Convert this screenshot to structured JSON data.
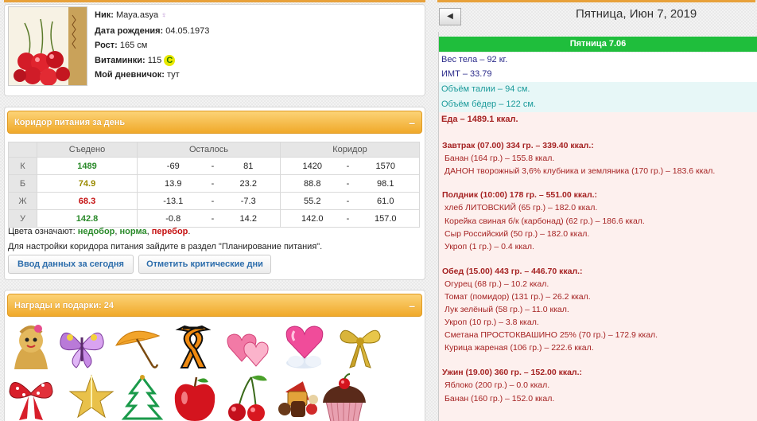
{
  "profile": {
    "nick_label": "Ник:",
    "nick": "Maya.asya",
    "dob_label": "Дата рождения:",
    "dob": "04.05.1973",
    "height_label": "Рост:",
    "height": "165 см",
    "vitamins_label": "Витаминки:",
    "vitamins": "115",
    "vitamin_badge": "C",
    "diary_label": "Мой дневничок:",
    "diary": "тут"
  },
  "corridor": {
    "title": "Коридор питания за день",
    "toggle": "–",
    "headers": [
      "",
      "Съедено",
      "Осталось",
      "Коридор"
    ],
    "rows": [
      {
        "label": "К",
        "eaten": "1489",
        "rem_min": "-69",
        "rem_max": "81",
        "cor_min": "1420",
        "cor_max": "1570"
      },
      {
        "label": "Б",
        "eaten": "74.9",
        "rem_min": "13.9",
        "rem_max": "23.2",
        "cor_min": "88.8",
        "cor_max": "98.1"
      },
      {
        "label": "Ж",
        "eaten": "68.3",
        "rem_min": "-13.1",
        "rem_max": "-7.3",
        "cor_min": "55.2",
        "cor_max": "61.0"
      },
      {
        "label": "У",
        "eaten": "142.8",
        "rem_min": "-0.8",
        "rem_max": "14.2",
        "cor_min": "142.0",
        "cor_max": "157.0"
      }
    ],
    "dash": "-",
    "legend_prefix": "Цвета означают:",
    "legend_under": "недобор",
    "legend_norm": "норма",
    "legend_over": "перебор",
    "note": "Для настройки коридора питания зайдите в раздел \"Планирование питания\".",
    "btn_today": "Ввод данных за сегодня",
    "btn_critical": "Отметить критические дни"
  },
  "awards": {
    "title": "Награды и подарки: 24",
    "toggle": "–",
    "items": [
      "doll-icon",
      "butterfly-icon",
      "umbrella-icon",
      "ribbon-icon",
      "hearts-icon",
      "heart-cloud-icon",
      "gold-bow-icon",
      "red-bow-icon",
      "gold-star-icon",
      "christmas-tree-icon",
      "apple-icon",
      "cherries-icon",
      "candies-icon",
      "cupcake-icon"
    ]
  },
  "day": {
    "nav_prev": "◀",
    "date_title": "Пятница, Июн 7, 2019",
    "bar": "Пятница 7.06",
    "weight": "Вес тела – 92 кг.",
    "bmi": "ИМТ – 33.79",
    "waist": "Объём талии – 94 см.",
    "hips": "Объём бёдер – 122 см.",
    "food": "Еда – 1489.1 ккал.",
    "meals": [
      {
        "title": "Завтрак (07.00) 334 гр. – 339.40 ккал.:",
        "items": [
          "Банан (164 гр.) – 155.8 ккал.",
          "ДАНОН творожный 3,6% клубника и земляника (170 гр.) – 183.6 ккал."
        ]
      },
      {
        "title": "Полдник (10:00) 178 гр. – 551.00 ккал.:",
        "items": [
          "хлеб ЛИТОВСКИЙ (65 гр.) – 182.0 ккал.",
          "Корейка свиная б/к (карбонад) (62 гр.) – 186.6 ккал.",
          "Сыр Российский (50 гр.) – 182.0 ккал.",
          "Укроп (1 гр.) – 0.4 ккал."
        ]
      },
      {
        "title": "Обед (15.00) 443 гр. – 446.70 ккал.:",
        "items": [
          "Огурец (68 гр.) – 10.2 ккал.",
          "Томат (помидор) (131 гр.) – 26.2 ккал.",
          "Лук зелёный (58 гр.) – 11.0 ккал.",
          "Укроп (10 гр.) – 3.8 ккал.",
          "Сметана ПРОСТОКВАШИНО 25% (70 гр.) – 172.9 ккал.",
          "Курица жареная (106 гр.) – 222.6 ккал."
        ]
      },
      {
        "title": "Ужин (19.00) 360 гр. – 152.00 ккал.:",
        "items": [
          "Яблоко (200 гр.) – 0.0 ккал.",
          "Банан (160 гр.) – 152.0 ккал."
        ]
      }
    ]
  },
  "colors": {
    "orange": "#f0a92a",
    "green_bar": "#1fbe3c",
    "under": "#2a8a2a",
    "over": "#c51111",
    "norm": "#2a8a2a"
  }
}
